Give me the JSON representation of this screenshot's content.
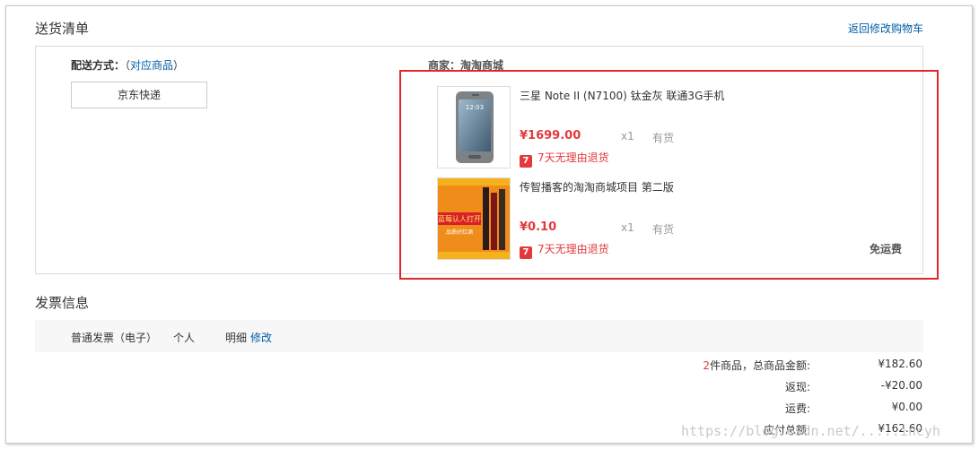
{
  "section": {
    "title": "送货清单",
    "back_link": "返回修改购物车"
  },
  "delivery": {
    "label": "配送方式：",
    "paren_open": "（",
    "link": "对应商品",
    "paren_close": "）",
    "method": "京东快递"
  },
  "seller": {
    "label": "商家：淘淘商城"
  },
  "items": [
    {
      "name": "三星 Note II (N7100) 钛金灰 联通3G手机",
      "price": "¥1699.00",
      "qty": "x1",
      "stock": "有货",
      "return_badge": "7",
      "return_text": "7天无理由退货"
    },
    {
      "name": "传智播客的淘淘商城项目 第二版",
      "price": "¥0.10",
      "qty": "x1",
      "stock": "有货",
      "return_badge": "7",
      "return_text": "7天无理由退货",
      "book_cover_text": "蓝莓认人打开",
      "book_cover_sub": "品质好红酒"
    }
  ],
  "shipping_free": "免运费",
  "invoice": {
    "title": "发票信息",
    "type": "普通发票（电子）",
    "person": "个人",
    "detail": "明细",
    "modify": "修改"
  },
  "summary": {
    "count": "2",
    "count_label": "件商品，总商品金额:",
    "total": "¥182.60",
    "rebate_label": "返现:",
    "rebate": "-¥20.00",
    "freight_label": "运费:",
    "freight": "¥0.00",
    "payable_label": "应付总额:",
    "payable": "¥162.60"
  },
  "watermark": "https://blog.csdn.net/.....incyh",
  "colors": {
    "accent_red": "#e4393c",
    "link_blue": "#005ea7",
    "highlight_border": "#e0282b"
  }
}
